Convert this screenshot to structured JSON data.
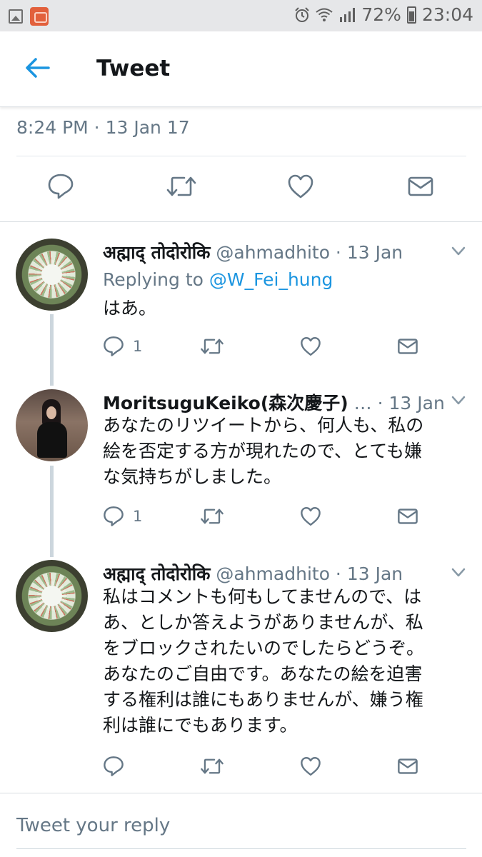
{
  "status_bar": {
    "battery": "72%",
    "time": "23:04",
    "icons": [
      "gallery-icon",
      "camera-app-icon",
      "alarm-icon",
      "wifi-icon",
      "signal-icon",
      "battery-icon"
    ]
  },
  "header": {
    "title": "Tweet",
    "back_icon": "back-arrow-icon"
  },
  "tweet": {
    "timestamp": "8:24 PM · 13 Jan 17",
    "actions": [
      "reply-icon",
      "retweet-icon",
      "like-icon",
      "message-icon"
    ]
  },
  "replies": [
    {
      "name": "अह्माद् तोदोरोकि",
      "meta": "@ahmadhito · 13 Jan",
      "replying_prefix": "Replying to",
      "replying_handle": "@W_Fei_hung",
      "text": "はあ。",
      "reply_count": "1"
    },
    {
      "name": "MoritsuguKeiko(森次慶子)",
      "meta": " … · 13 Jan",
      "text": "あなたのリツイートから、何人も、私の\n絵を否定する方が現れたので、とても嫌\nな気持ちがしました。",
      "reply_count": "1"
    },
    {
      "name": "अह्माद् तोदोरोकि",
      "meta": "@ahmadhito · 13 Jan",
      "text": "私はコメントも何もしてませんので、は\nあ、としか答えようがありませんが、私\nをブロックされたいのでしたらどうぞ。\nあなたのご自由です。あなたの絵を迫害\nする権利は誰にもありませんが、嫌う権\n利は誰にでもあります。",
      "reply_count": ""
    }
  ],
  "composer": {
    "placeholder": "Tweet your reply"
  },
  "colors": {
    "accent": "#1b95e0",
    "secondary_text": "#657786",
    "icon": "#657786"
  }
}
